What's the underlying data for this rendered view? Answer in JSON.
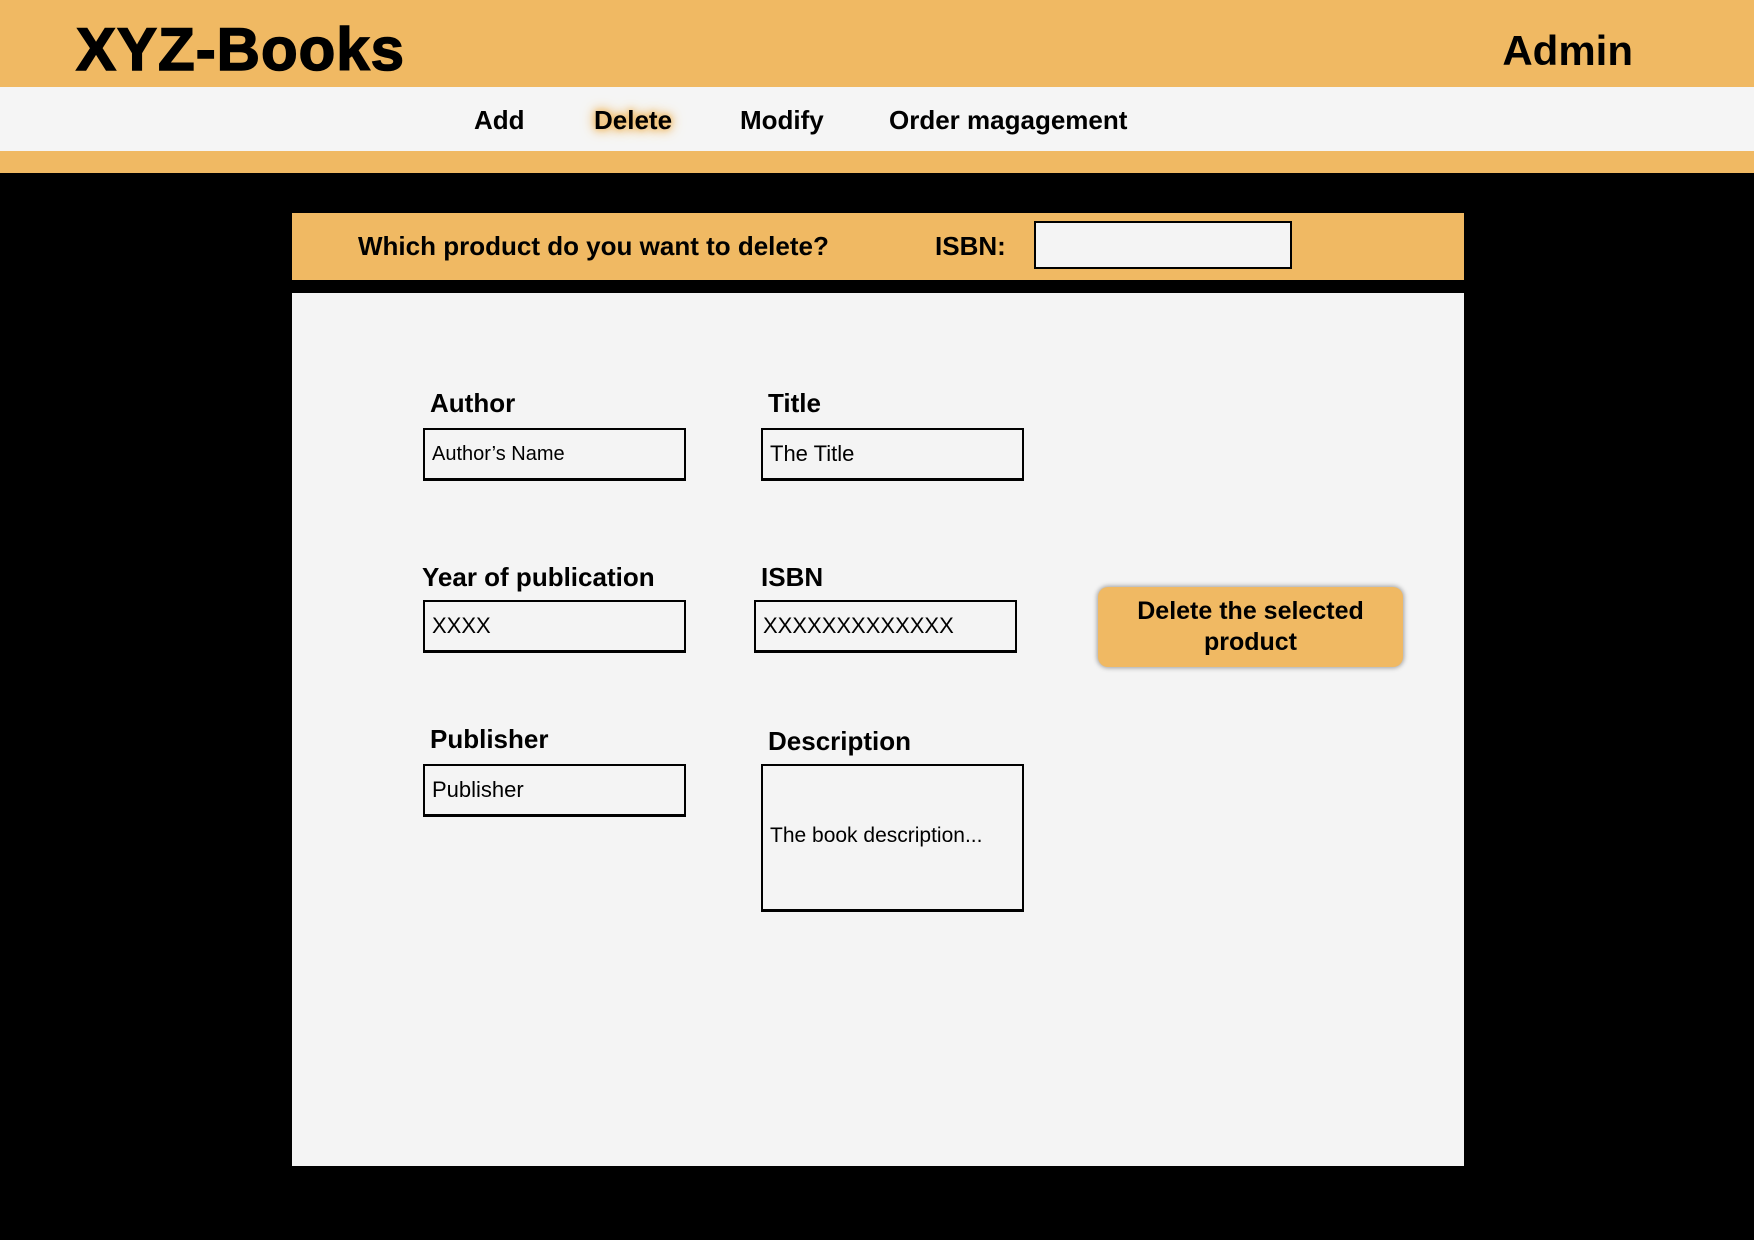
{
  "header": {
    "logo": "XYZ-Books",
    "user": "Admin"
  },
  "nav": {
    "items": [
      {
        "label": "Add"
      },
      {
        "label": "Delete",
        "active": true
      },
      {
        "label": "Modify"
      },
      {
        "label": "Order magagement"
      }
    ]
  },
  "search": {
    "question": "Which product do you want to delete?",
    "isbn_label": "ISBN:",
    "isbn_value": ""
  },
  "form": {
    "author": {
      "label": "Author",
      "value": "Author’s Name"
    },
    "title": {
      "label": "Title",
      "value": "The Title"
    },
    "year": {
      "label": "Year of publication",
      "value": "XXXX"
    },
    "isbn": {
      "label": "ISBN",
      "value": "XXXXXXXXXXXXX"
    },
    "publisher": {
      "label": "Publisher",
      "value": "Publisher"
    },
    "description": {
      "label": "Description",
      "value": "The book description..."
    }
  },
  "actions": {
    "delete_label": "Delete the selected product"
  },
  "colors": {
    "accent": "#F0B963",
    "panel": "#F4F4F4",
    "nav_background": "#F5F5F5",
    "page_background": "#000000"
  }
}
